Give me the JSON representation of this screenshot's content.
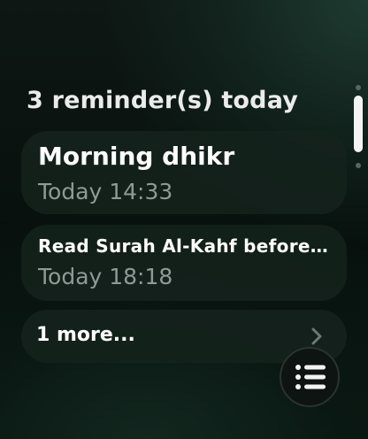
{
  "header": {
    "title": "3 reminder(s) today"
  },
  "reminders": [
    {
      "title": "Morning dhikr",
      "time": "Today 14:33"
    },
    {
      "title": "Read Surah Al-Kahf before Jumu'ah",
      "time": "Today 18:18"
    }
  ],
  "more": {
    "label": "1 more..."
  },
  "icons": {
    "chevron": "chevron-right-icon",
    "list": "list-icon"
  },
  "colors": {
    "background": "#0a1a14",
    "card": "#14221d",
    "secondary_text": "#8e9a96",
    "scroll_thumb": "#f4f4f4"
  }
}
